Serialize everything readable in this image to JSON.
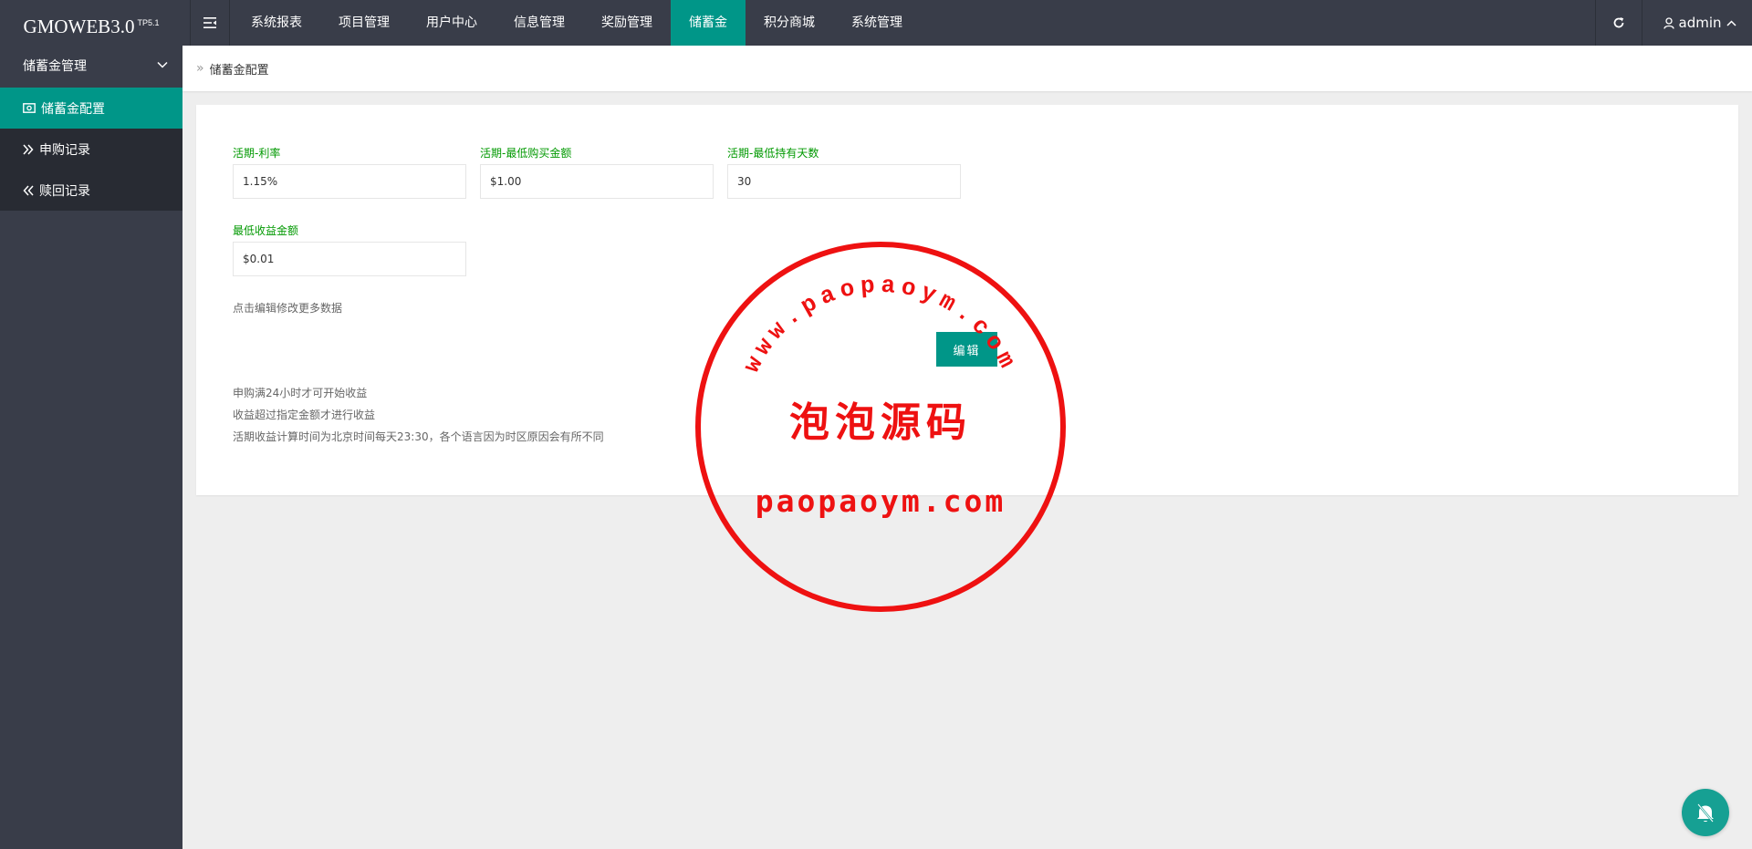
{
  "header": {
    "logo": "GMOWEB3.0",
    "logo_sup": "TP5.1",
    "nav": [
      "系统报表",
      "项目管理",
      "用户中心",
      "信息管理",
      "奖励管理",
      "储蓄金",
      "积分商城",
      "系统管理"
    ],
    "active_nav": "储蓄金",
    "user": "admin"
  },
  "sidebar": {
    "group": "储蓄金管理",
    "items": [
      "储蓄金配置",
      "申购记录",
      "赎回记录"
    ]
  },
  "breadcrumb": "储蓄金配置",
  "form": {
    "rate_label": "活期-利率",
    "rate_value": "1.15%",
    "min_amount_label": "活期-最低购买金额",
    "min_amount_value": "$1.00",
    "min_days_label": "活期-最低持有天数",
    "min_days_value": "30",
    "min_income_label": "最低收益金额",
    "min_income_value": "$0.01",
    "hint": "点击编辑修改更多数据",
    "edit_label": "编辑"
  },
  "notes": [
    "申购满24小时才可开始收益",
    "收益超过指定金额才进行收益",
    "活期收益计算时间为北京时间每天23:30，各个语言因为时区原因会有所不同"
  ],
  "watermark": {
    "top_arc": "www.paopaoym.com",
    "center": "泡泡源码",
    "bottom": "paopaoym.com"
  },
  "colors": {
    "header_bg": "#393d49",
    "accent": "#009688",
    "label_green": "#009900",
    "stamp_red": "#ee1111"
  }
}
